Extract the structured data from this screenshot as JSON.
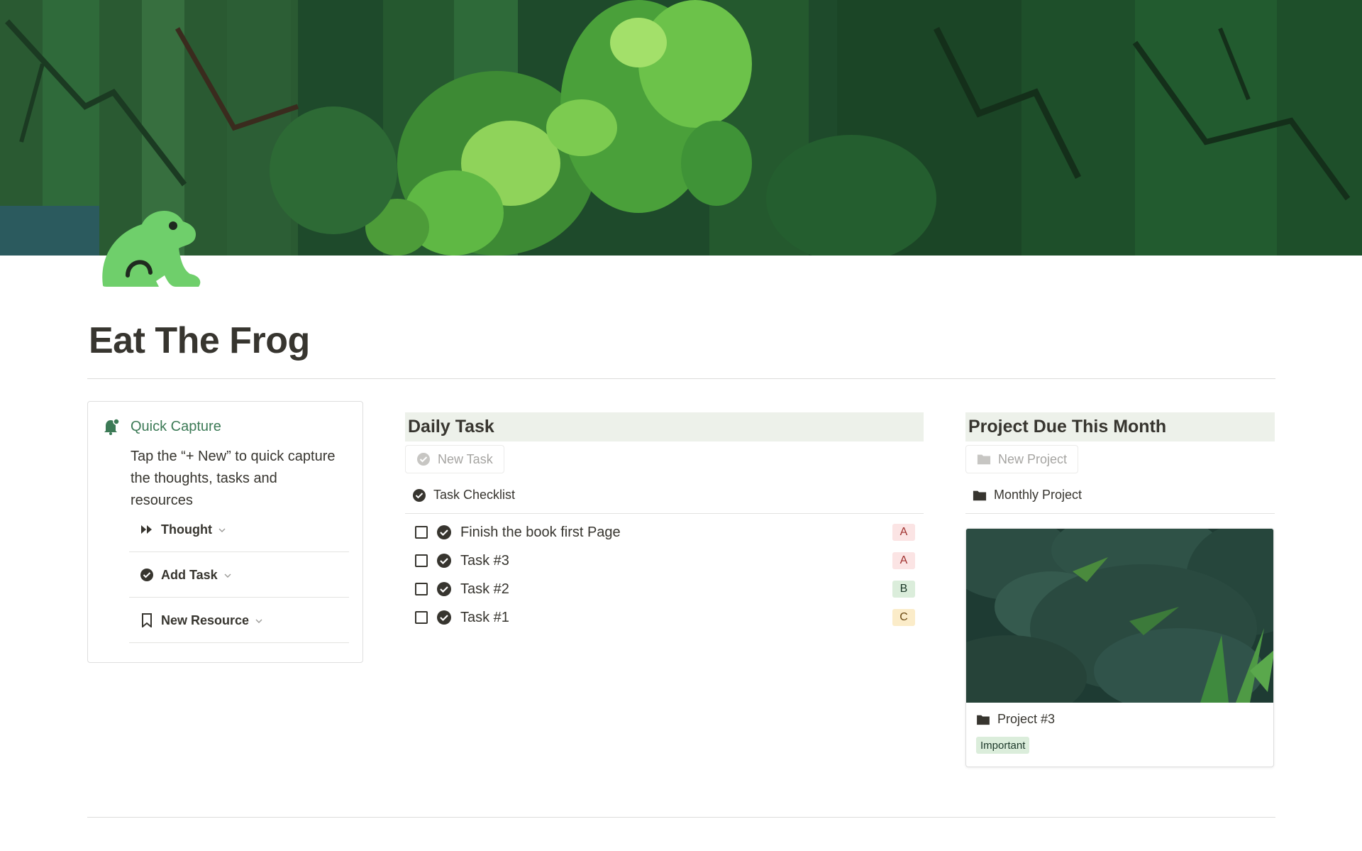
{
  "page": {
    "title": "Eat The Frog"
  },
  "quick_capture": {
    "title": "Quick Capture",
    "description": "Tap the “+ New” to quick capture the thoughts, tasks and resources",
    "buttons": [
      {
        "label": "Thought",
        "icon": "fast-forward-icon"
      },
      {
        "label": "Add Task",
        "icon": "check-circle-icon"
      },
      {
        "label": "New Resource",
        "icon": "bookmark-icon"
      }
    ]
  },
  "daily_task": {
    "heading": "Daily Task",
    "new_button": "New Task",
    "view_name": "Task Checklist",
    "tasks": [
      {
        "name": "Finish the book first Page",
        "priority": "A",
        "checked": false
      },
      {
        "name": "Task #3",
        "priority": "A",
        "checked": false
      },
      {
        "name": "Task #2",
        "priority": "B",
        "checked": false
      },
      {
        "name": "Task #1",
        "priority": "C",
        "checked": false
      }
    ]
  },
  "projects": {
    "heading": "Project Due This Month",
    "new_button": "New Project",
    "view_name": "Monthly Project",
    "cards": [
      {
        "title": "Project #3",
        "tag": "Important"
      }
    ]
  },
  "colors": {
    "accent_green": "#3c7a56",
    "frog_green": "#6fcf6b",
    "heading_bg": "#edf1ea",
    "priority_a_bg": "#fbe4e4",
    "priority_a_text": "#9f2f2d",
    "priority_b_bg": "#dbeddb",
    "priority_b_text": "#1c3829",
    "priority_c_bg": "#fbecc9",
    "priority_c_text": "#6b4a14",
    "tag_important_bg": "#dbeddb",
    "tag_important_text": "#1c3829"
  }
}
